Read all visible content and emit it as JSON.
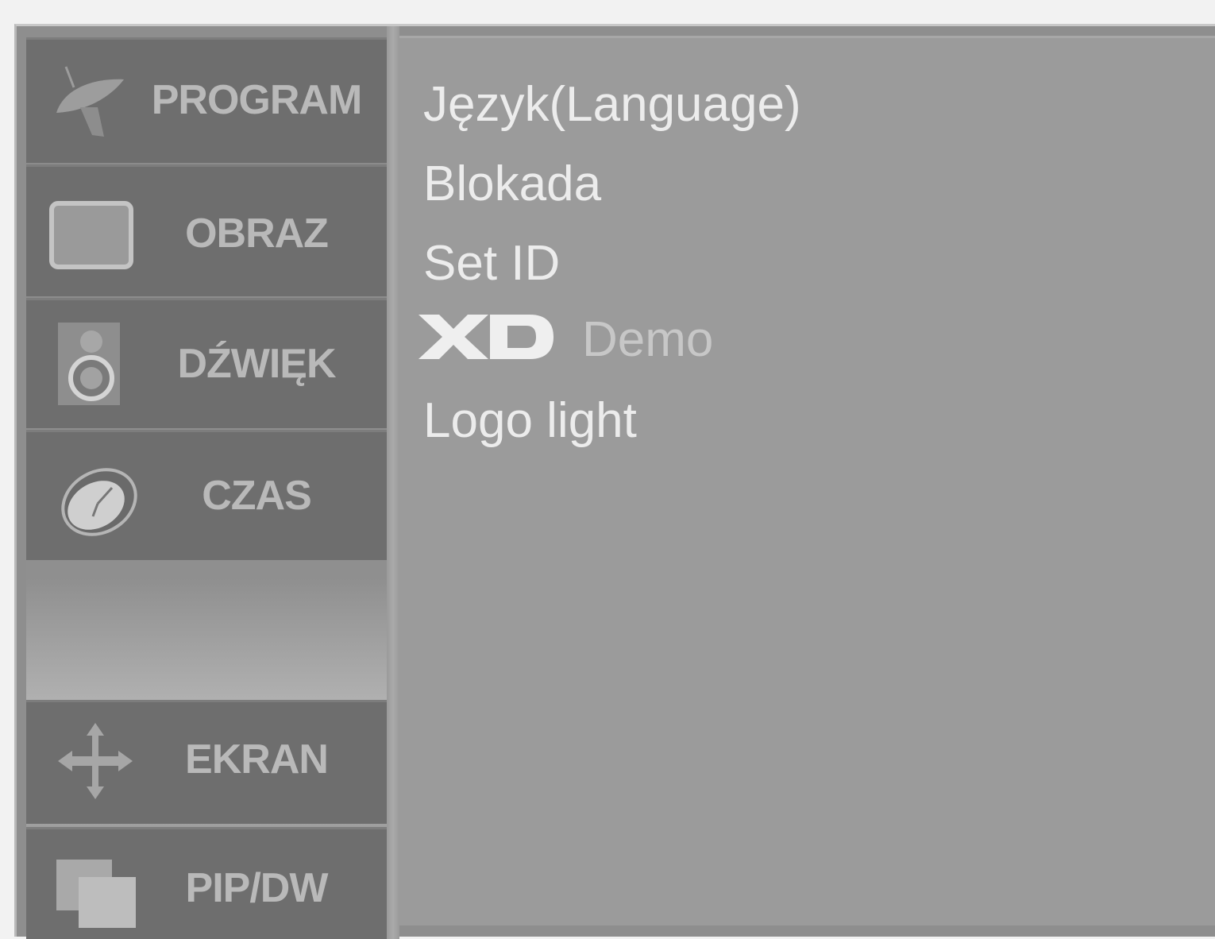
{
  "sidebar": {
    "items": [
      {
        "label": "PROGRAM",
        "icon": "satellite-dish-icon"
      },
      {
        "label": "OBRAZ",
        "icon": "tv-screen-icon"
      },
      {
        "label": "DŹWIĘK",
        "icon": "speaker-icon"
      },
      {
        "label": "CZAS",
        "icon": "clock-icon"
      },
      {
        "label": "EKRAN",
        "icon": "move-arrows-icon"
      },
      {
        "label": "PIP/DW",
        "icon": "pip-windows-icon"
      }
    ]
  },
  "options": {
    "items": [
      {
        "label": "Język(Language)"
      },
      {
        "label": "Blokada"
      },
      {
        "label": "Set ID"
      },
      {
        "label": "Demo",
        "logo": "XD"
      },
      {
        "label": "Logo light"
      }
    ]
  },
  "colors": {
    "menu_bg": "#6e6e6e",
    "menu_label": "#b9b9b9",
    "content_bg": "#9b9b9b",
    "option_text": "#ececec"
  }
}
